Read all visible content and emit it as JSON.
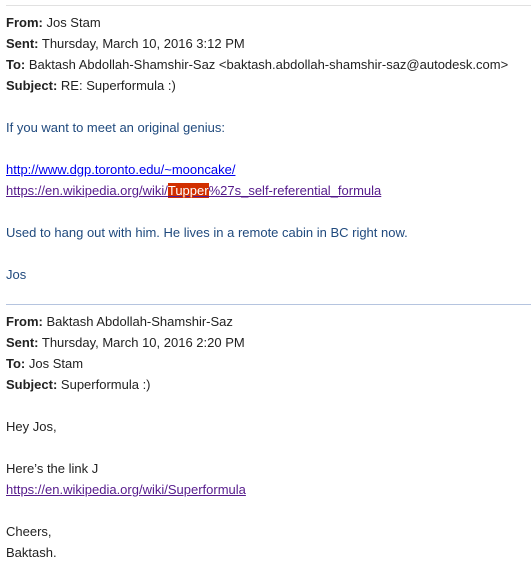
{
  "colors": {
    "body_text": "#1f497d",
    "link": "#0000ee",
    "visited_link": "#551a8b",
    "highlight": "#d12f00"
  },
  "labels": {
    "from": "From:",
    "sent": "Sent:",
    "to": "To:",
    "subject": "Subject:"
  },
  "reply": {
    "from": "Jos Stam",
    "sent": "Thursday, March 10, 2016 3:12 PM",
    "to": "Baktash Abdollah-Shamshir-Saz <baktash.abdollah-shamshir-saz@autodesk.com>",
    "subject": "RE: Superformula :)",
    "intro": "If you want to meet an original genius:",
    "link1": "http://www.dgp.toronto.edu/~mooncake/",
    "link2_pre": "https://en.wikipedia.org/wiki/",
    "link2_highlight": "Tupper",
    "link2_post": "%27s_self-referential_formula",
    "para": "Used to hang out with him. He lives in a remote cabin in BC right now.",
    "signature": "Jos"
  },
  "original": {
    "from": "Baktash Abdollah-Shamshir-Saz",
    "sent": "Thursday, March 10, 2016 2:20 PM",
    "to": "Jos Stam",
    "subject": "Superformula :)",
    "greeting": "Hey Jos,",
    "line1": "Here’s the link J",
    "link": "https://en.wikipedia.org/wiki/Superformula",
    "closing": "Cheers,",
    "signature": "Baktash."
  }
}
